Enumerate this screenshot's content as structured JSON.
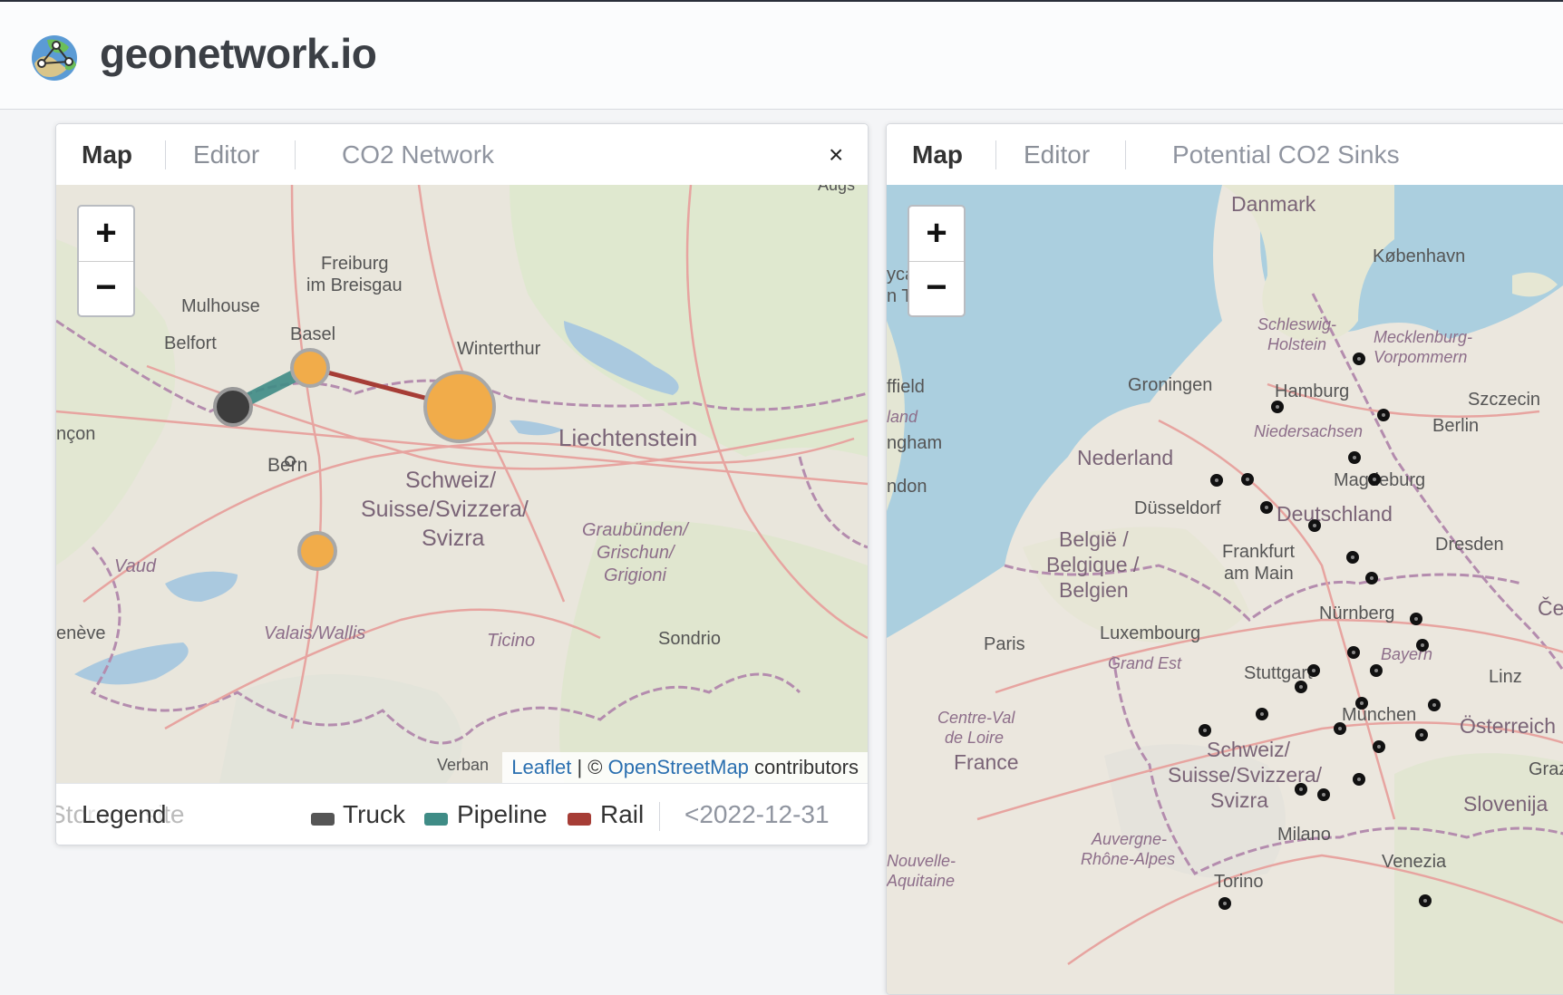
{
  "app": {
    "brand": "geonetwork.io"
  },
  "panels": [
    {
      "tabs": [
        "Map",
        "Editor"
      ],
      "title": "CO2 Network",
      "close": "×",
      "zoom_in": "+",
      "zoom_out": "−",
      "map_labels": {
        "freiburg": "Freiburg",
        "breisgau": "im Breisgau",
        "mulhouse": "Mulhouse",
        "belfort": "Belfort",
        "basel": "Basel",
        "winterthur": "Winterthur",
        "liechtenstein": "Liechtenstein",
        "bern": "Bern",
        "schweiz1": "Schweiz/",
        "schweiz2": "Suisse/Svizzera/",
        "schweiz3": "Svizra",
        "graub1": "Graubünden/",
        "graub2": "Grischun/",
        "graub3": "Grigioni",
        "vaud": "Vaud",
        "valais": "Valais/Wallis",
        "ticino": "Ticino",
        "sondrio": "Sondrio",
        "geneve": "enève",
        "ncon": "nçon",
        "verban": "Verban",
        "augs": "Augs"
      },
      "attribution": {
        "leaflet": "Leaflet",
        "sep": "| ©",
        "osm": "OpenStreetMap",
        "contributors": "contributors"
      },
      "legend": {
        "title": "Legend",
        "storage": "Storage site",
        "truck": "Truck",
        "pipeline": "Pipeline",
        "rail": "Rail",
        "date": "<2022-12-31"
      },
      "colors": {
        "source": "#f1ac4a",
        "storage": "#3d3d3d",
        "truck": "#555555",
        "pipeline": "#3f8c86",
        "rail": "#a63d36"
      }
    },
    {
      "tabs": [
        "Map",
        "Editor"
      ],
      "title": "Potential CO2 Sinks",
      "zoom_in": "+",
      "zoom_out": "−",
      "map_labels": {
        "danmark": "Danmark",
        "kobenhavn": "København",
        "schleswig1": "Schleswig-",
        "schleswig2": "Holstein",
        "meck1": "Mecklenburg-",
        "meck2": "Vorpommern",
        "hamburg": "Hamburg",
        "szczecin": "Szczecin",
        "groningen": "Groningen",
        "berlin": "Berlin",
        "nieder": "Niedersachsen",
        "nederland": "Nederland",
        "magdeburg": "Magdeburg",
        "dusseldorf": "Düsseldorf",
        "deutschland": "Deutschland",
        "belgie1": "België /",
        "belgie2": "Belgique /",
        "belgie3": "Belgien",
        "frankfurt1": "Frankfurt",
        "frankfurt2": "am Main",
        "dresden": "Dresden",
        "nurnberg": "Nürnberg",
        "cesk": "Česk",
        "paris": "Paris",
        "luxembourg": "Luxembourg",
        "bayern": "Bayern",
        "grandest": "Grand Est",
        "stuttgart": "Stuttgart",
        "linz": "Linz",
        "munchen": "München",
        "osterreich": "Österreich",
        "centre1": "Centre-Val",
        "centre2": "de Loire",
        "france": "France",
        "schweiz1": "Schweiz/",
        "schweiz2": "Suisse/Svizzera/",
        "schweiz3": "Svizra",
        "graz": "Graz",
        "slovenija": "Slovenija",
        "auv1": "Auvergne-",
        "auv2": "Rhône-Alpes",
        "milano": "Milano",
        "venezia": "Venezia",
        "torino": "Torino",
        "nouvelle1": "Nouvelle-",
        "nouvelle2": "Aquitaine",
        "ffield": "ffield",
        "land": "land",
        "ngham": "ngham",
        "ndon": "ndon",
        "yca": "yca",
        "nty": "n Ty"
      },
      "sink_count": 30
    }
  ]
}
